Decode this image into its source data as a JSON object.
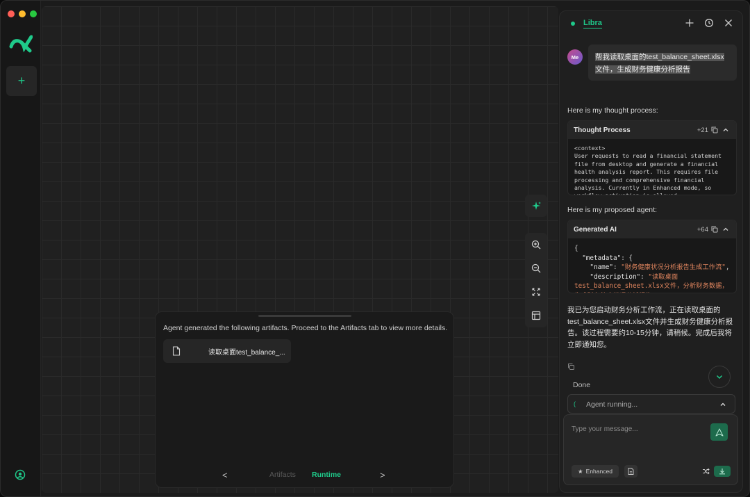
{
  "chat": {
    "title": "Libra",
    "user_avatar": "Me",
    "user_message": "帮我读取桌面的test_balance_sheet.xlsx文件，生成财务健康分析报告",
    "thought_label": "Here is my thought process:",
    "thought_card": {
      "title": "Thought Process",
      "count": "+21",
      "body": "<context>\nUser requests to read a financial statement file from desktop and generate a financial health analysis report. This requires file processing and comprehensive financial analysis. Currently in Enhanced mode, so workflow activation is allowed."
    },
    "agent_label": "Here is my proposed agent:",
    "agent_card": {
      "title": "Generated AI",
      "count": "+64",
      "line1": "{",
      "line2_key": "\"metadata\"",
      "line2_rest": ": {",
      "line3_key": "\"name\"",
      "line3_val": "\"财务健康状况分析报告生成工作流\"",
      "line4_key": "\"description\"",
      "line4_val": "\"读取桌面test_balance_sheet.xlsx文件，分析财务数据，生成财务健康状况分析报告\""
    },
    "reply": "我已为您启动财务分析工作流，正在读取桌面的test_balance_sheet.xlsx文件并生成财务健康分析报告。该过程需要约10-15分钟，请稍候。完成后我将立即通知您。",
    "done": "Done",
    "running_status": "Agent running...",
    "input_placeholder": "Type your message...",
    "enhanced_label": "Enhanced"
  },
  "artifacts": {
    "message": "Agent generated the following artifacts. Proceed to the Artifacts tab to view more details.",
    "file_name": "读取桌面test_balance_...",
    "tab_artifacts": "Artifacts",
    "tab_runtime": "Runtime",
    "prev": "<",
    "next": ">"
  },
  "colors": {
    "accent": "#1fc98a",
    "background": "#1b1b1b",
    "panel": "#1f1f1f"
  }
}
